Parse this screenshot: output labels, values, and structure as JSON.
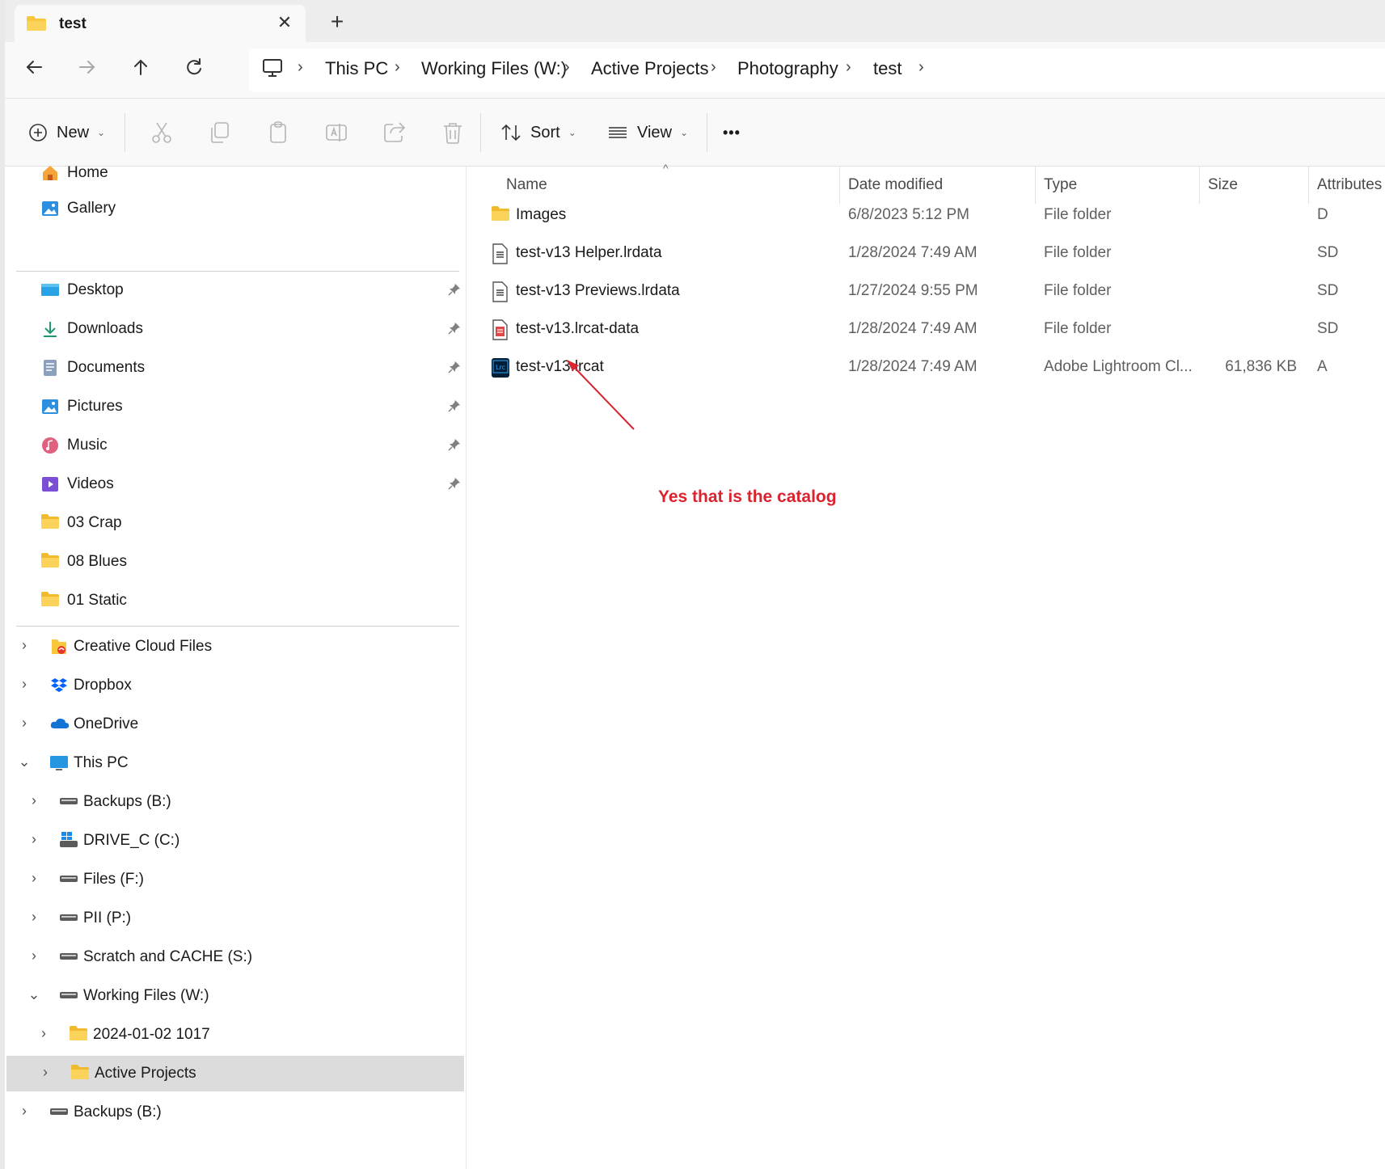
{
  "tab": {
    "title": "test",
    "close_label": "✕",
    "new_tab_label": "+"
  },
  "breadcrumbs": [
    "This PC",
    "Working Files (W:)",
    "Active Projects",
    "Photography",
    "test"
  ],
  "toolbar": {
    "new_label": "New",
    "sort_label": "Sort",
    "view_label": "View",
    "more_label": "•••"
  },
  "columns": {
    "name": "Name",
    "date": "Date modified",
    "type": "Type",
    "size": "Size",
    "attributes": "Attributes"
  },
  "files": [
    {
      "icon": "folder-icon",
      "name": "Images",
      "date": "6/8/2023 5:12 PM",
      "type": "File folder",
      "size": "",
      "attributes": "D"
    },
    {
      "icon": "data-file-icon",
      "name": "test-v13 Helper.lrdata",
      "date": "1/28/2024 7:49 AM",
      "type": "File folder",
      "size": "",
      "attributes": "SD"
    },
    {
      "icon": "data-file-icon",
      "name": "test-v13 Previews.lrdata",
      "date": "1/27/2024 9:55 PM",
      "type": "File folder",
      "size": "",
      "attributes": "SD"
    },
    {
      "icon": "red-data-file-icon",
      "name": "test-v13.lrcat-data",
      "date": "1/28/2024 7:49 AM",
      "type": "File folder",
      "size": "",
      "attributes": "SD"
    },
    {
      "icon": "lightroom-catalog-icon",
      "name": "test-v13.lrcat",
      "date": "1/28/2024 7:49 AM",
      "type": "Adobe Lightroom Cl...",
      "size": "61,836 KB",
      "attributes": "A"
    }
  ],
  "annotation": "Yes that is the catalog",
  "lrc_badge": "Lrc",
  "sidebar": {
    "top": [
      {
        "icon": "home-icon",
        "label": "Home"
      },
      {
        "icon": "gallery-icon",
        "label": "Gallery"
      }
    ],
    "quick_access": [
      {
        "icon": "desktop-icon",
        "label": "Desktop",
        "pinned": true
      },
      {
        "icon": "downloads-icon",
        "label": "Downloads",
        "pinned": true
      },
      {
        "icon": "documents-icon",
        "label": "Documents",
        "pinned": true
      },
      {
        "icon": "pictures-icon",
        "label": "Pictures",
        "pinned": true
      },
      {
        "icon": "music-icon",
        "label": "Music",
        "pinned": true
      },
      {
        "icon": "videos-icon",
        "label": "Videos",
        "pinned": true
      },
      {
        "icon": "folder-icon",
        "label": "03 Crap",
        "pinned": false
      },
      {
        "icon": "folder-icon",
        "label": "08 Blues",
        "pinned": false
      },
      {
        "icon": "folder-icon",
        "label": "01 Static",
        "pinned": false
      }
    ],
    "tree": [
      {
        "icon": "creative-cloud-icon",
        "label": "Creative Cloud Files",
        "expander": "›",
        "level": 0
      },
      {
        "icon": "dropbox-icon",
        "label": "Dropbox",
        "expander": "›",
        "level": 0
      },
      {
        "icon": "onedrive-icon",
        "label": "OneDrive",
        "expander": "›",
        "level": 0
      },
      {
        "icon": "this-pc-icon",
        "label": "This PC",
        "expander": "⌄",
        "level": 0
      },
      {
        "icon": "drive-icon",
        "label": "Backups (B:)",
        "expander": "›",
        "level": 1
      },
      {
        "icon": "windows-drive-icon",
        "label": "DRIVE_C (C:)",
        "expander": "›",
        "level": 1
      },
      {
        "icon": "drive-icon",
        "label": "Files (F:)",
        "expander": "›",
        "level": 1
      },
      {
        "icon": "drive-icon",
        "label": "PII (P:)",
        "expander": "›",
        "level": 1
      },
      {
        "icon": "drive-icon",
        "label": "Scratch and CACHE (S:)",
        "expander": "›",
        "level": 1
      },
      {
        "icon": "drive-icon",
        "label": "Working Files (W:)",
        "expander": "⌄",
        "level": 1
      },
      {
        "icon": "folder-icon",
        "label": "2024-01-02 1017",
        "expander": "›",
        "level": 2
      },
      {
        "icon": "folder-icon",
        "label": "Active Projects",
        "expander": "›",
        "level": 2,
        "selected": true
      },
      {
        "icon": "drive-icon",
        "label": "Backups (B:)",
        "expander": "›",
        "level": 0
      }
    ]
  },
  "colors": {
    "accent": "#0067c0",
    "folder": "#f8c73e",
    "annotation": "#d9242f",
    "selection": "#dcdcdc"
  }
}
